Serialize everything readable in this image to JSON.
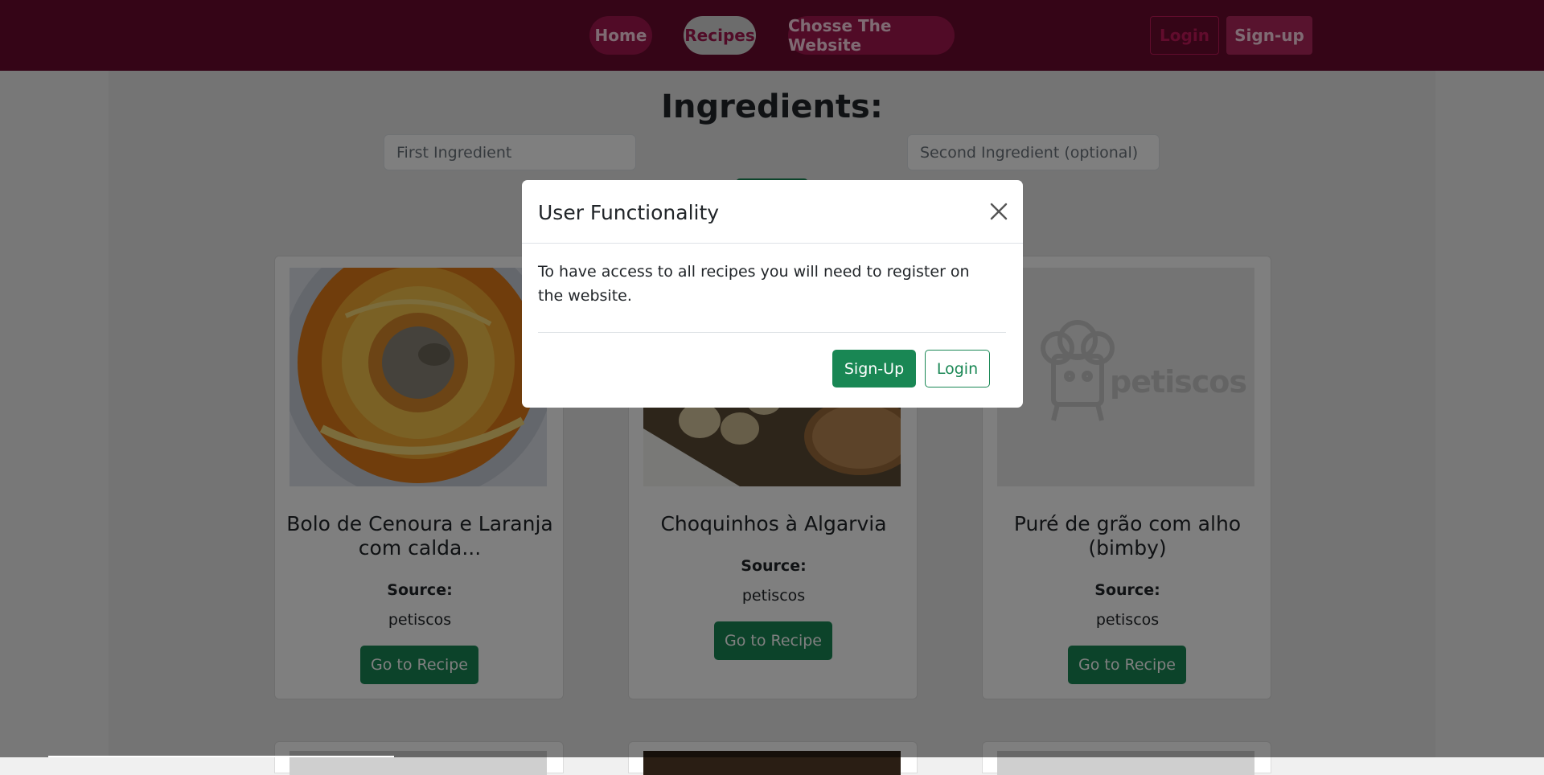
{
  "nav": {
    "home": "Home",
    "recipes": "Recipes",
    "choose": "Chosse The Website",
    "login": "Login",
    "signup": "Sign-up"
  },
  "search": {
    "heading": "Ingredients:",
    "first_placeholder": "First Ingredient",
    "second_placeholder": "Second Ingredient (optional)"
  },
  "cards": [
    {
      "title": "Bolo de Cenoura e Laranja com calda...",
      "source_label": "Source:",
      "source": "petiscos",
      "button": "Go to Recipe"
    },
    {
      "title": "Choquinhos à Algarvia",
      "source_label": "Source:",
      "source": "petiscos",
      "button": "Go to Recipe"
    },
    {
      "title": "Puré de grão com alho (bimby)",
      "source_label": "Source:",
      "source": "petiscos",
      "button": "Go to Recipe",
      "placeholder_logo": "petiscos"
    }
  ],
  "modal": {
    "title": "User Functionality",
    "body": "To have access to all recipes you will need to register on the website.",
    "signup": "Sign-Up",
    "login": "Login"
  },
  "colors": {
    "navbar": "#6b0a2e",
    "accent_pink": "#a3164f",
    "success_green": "#198754"
  }
}
